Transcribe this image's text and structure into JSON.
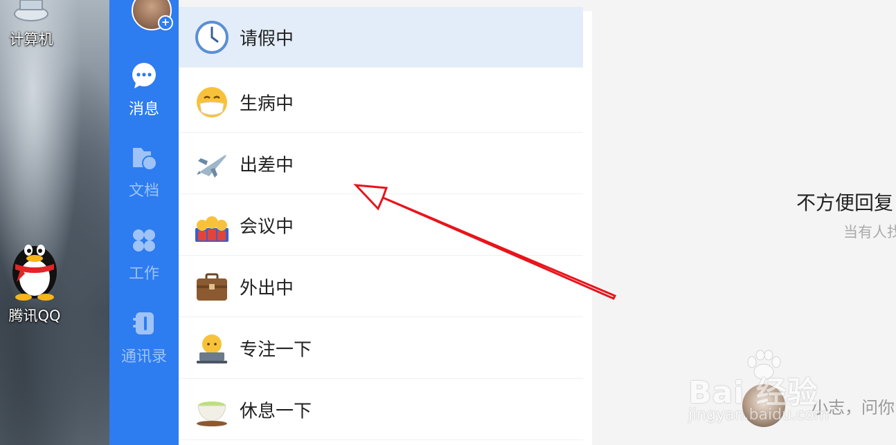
{
  "desktop": {
    "computer_label": "计算机",
    "qq_label": "腾讯QQ"
  },
  "sidebar": {
    "items": [
      {
        "label": "消息",
        "icon": "chat-bubble-icon",
        "active": true
      },
      {
        "label": "文档",
        "icon": "folder-icon",
        "active": false
      },
      {
        "label": "工作",
        "icon": "apps-grid-icon",
        "active": false
      },
      {
        "label": "通讯录",
        "icon": "contacts-book-icon",
        "active": false
      }
    ]
  },
  "status_menu": {
    "items": [
      {
        "label": "请假中",
        "icon": "clock-icon",
        "selected": true
      },
      {
        "label": "生病中",
        "icon": "mask-face-icon",
        "selected": false
      },
      {
        "label": "出差中",
        "icon": "airplane-icon",
        "selected": false
      },
      {
        "label": "会议中",
        "icon": "meeting-people-icon",
        "selected": false
      },
      {
        "label": "外出中",
        "icon": "briefcase-icon",
        "selected": false
      },
      {
        "label": "专注一下",
        "icon": "laptop-person-icon",
        "selected": false
      },
      {
        "label": "休息一下",
        "icon": "tea-cup-icon",
        "selected": false
      }
    ]
  },
  "right_panel": {
    "title": "不方便回复",
    "subtitle": "当有人找",
    "preview_text": "小志，问你"
  },
  "watermark": {
    "brand": "Bai 经验",
    "url": "jingyan.baidu.com"
  },
  "colors": {
    "sidebar_blue": "#2d7cf0",
    "selected_row": "#e3edf9",
    "arrow_red": "#e8141b"
  }
}
